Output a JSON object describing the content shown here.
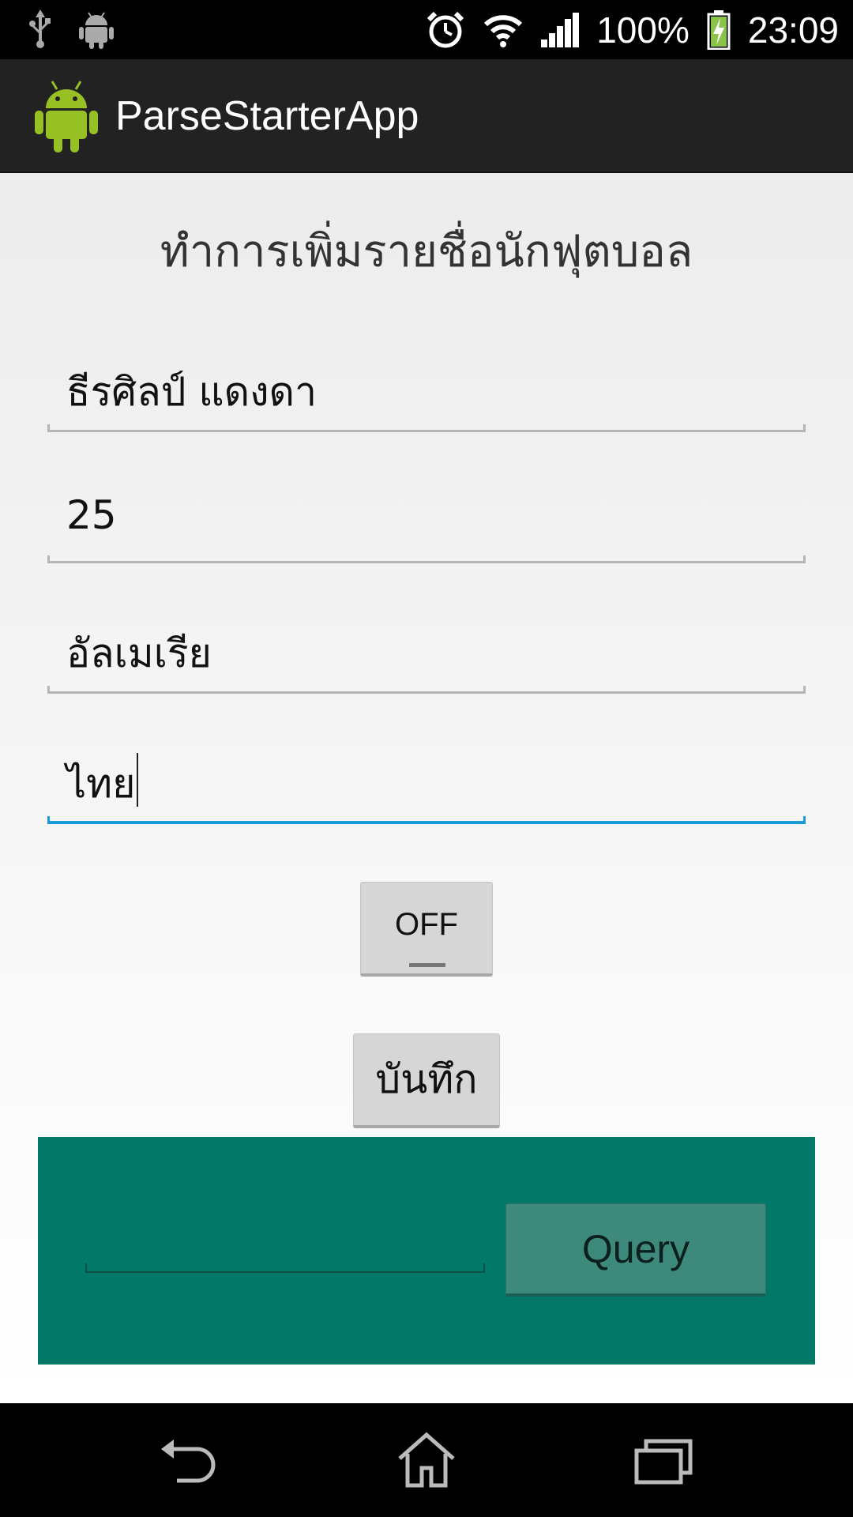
{
  "status_bar": {
    "battery": "100%",
    "time": "23:09",
    "icons": [
      "usb-icon",
      "android-debug-icon",
      "alarm-icon",
      "wifi-icon",
      "signal-icon",
      "battery-charging-icon"
    ]
  },
  "action_bar": {
    "title": "ParseStarterApp",
    "logo_icon": "android-logo-icon"
  },
  "form": {
    "heading": "ทำการเพิ่มรายชื่อนักฟุตบอล",
    "fields": [
      {
        "value": "ธีรศิลป์ แดงดา"
      },
      {
        "value": "25"
      },
      {
        "value": "อัลเมเรีย"
      },
      {
        "value": "ไทย",
        "focused": true
      }
    ],
    "toggle_label": "OFF",
    "save_label": "บันทึก"
  },
  "query_panel": {
    "input_value": "",
    "button_label": "Query"
  },
  "nav_bar": {
    "icons": [
      "back-icon",
      "home-icon",
      "recents-icon"
    ]
  },
  "colors": {
    "accent": "#1a9ad6",
    "panel": "#027868",
    "action_bar": "#222222"
  }
}
